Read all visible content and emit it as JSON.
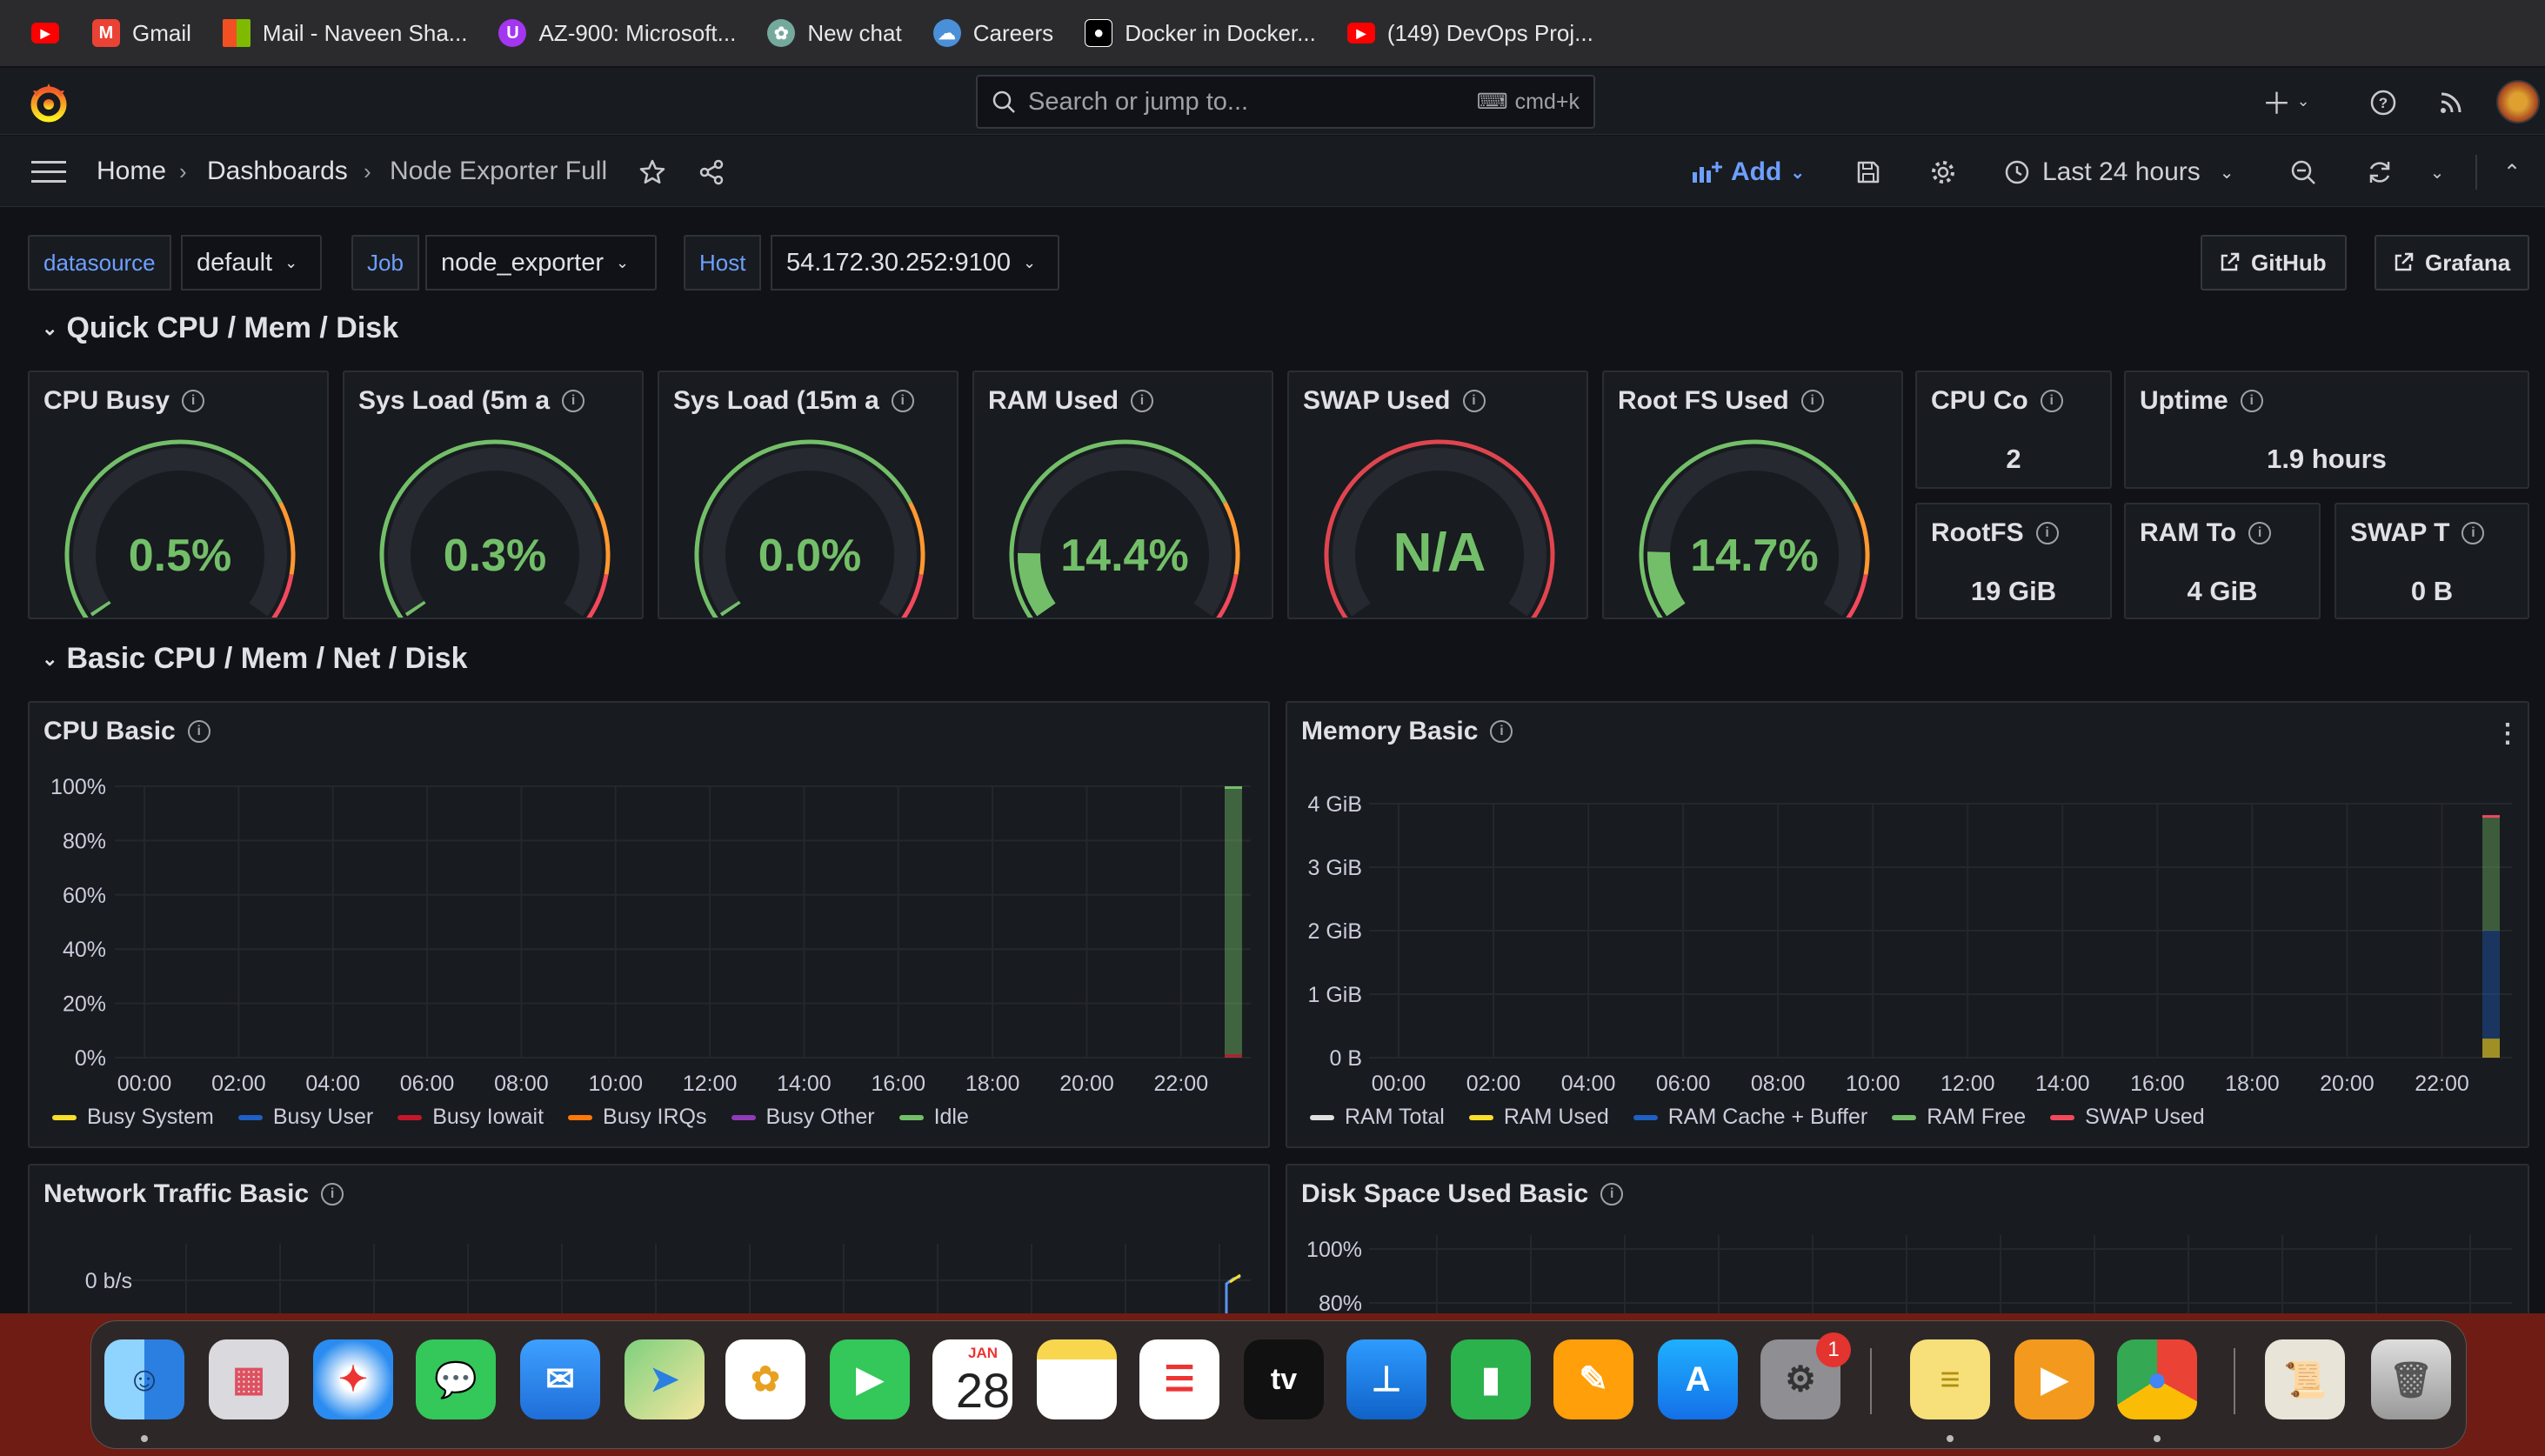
{
  "bookmarks": [
    {
      "label": "",
      "icon": "youtube-icon",
      "color": "#ff0000"
    },
    {
      "label": "Gmail",
      "icon": "gmail-icon",
      "color": "#ea4335"
    },
    {
      "label": "Mail - Naveen Sha...",
      "icon": "microsoft-icon",
      "color": "#f25022"
    },
    {
      "label": "AZ-900: Microsoft...",
      "icon": "udemy-icon",
      "color": "#a435f0"
    },
    {
      "label": "New chat",
      "icon": "chatgpt-icon",
      "color": "#74aa9c"
    },
    {
      "label": "Careers",
      "icon": "careers-icon",
      "color": "#4a90d9"
    },
    {
      "label": "Docker in Docker...",
      "icon": "medium-icon",
      "color": "#000000"
    },
    {
      "label": "(149) DevOps Proj...",
      "icon": "youtube-icon",
      "color": "#ff0000"
    }
  ],
  "topnav": {
    "search_placeholder": "Search or jump to...",
    "search_shortcut": "cmd+k"
  },
  "breadcrumb": {
    "home": "Home",
    "dashboards": "Dashboards",
    "current": "Node Exporter Full"
  },
  "toolbar": {
    "add_label": "Add",
    "time_range": "Last 24 hours"
  },
  "variables": {
    "datasource_label": "datasource",
    "datasource_value": "default",
    "job_label": "Job",
    "job_value": "node_exporter",
    "host_label": "Host",
    "host_value": "54.172.30.252:9100",
    "github_link": "GitHub",
    "grafana_link": "Grafana"
  },
  "rows": {
    "quick": "Quick CPU / Mem / Disk",
    "basic": "Basic CPU / Mem / Net / Disk"
  },
  "gauges": [
    {
      "title": "CPU Busy",
      "value_text": "0.5%",
      "value": 0.5,
      "value_color": "#73bf69"
    },
    {
      "title": "Sys Load (5m a",
      "value_text": "0.3%",
      "value": 0.3,
      "value_color": "#73bf69"
    },
    {
      "title": "Sys Load (15m a",
      "value_text": "0.0%",
      "value": 0.0,
      "value_color": "#73bf69"
    },
    {
      "title": "RAM Used",
      "value_text": "14.4%",
      "value": 14.4,
      "value_color": "#73bf69"
    },
    {
      "title": "SWAP Used",
      "value_text": "N/A",
      "value": null,
      "value_color": "#73bf69"
    },
    {
      "title": "Root FS Used",
      "value_text": "14.7%",
      "value": 14.7,
      "value_color": "#73bf69"
    }
  ],
  "stats": {
    "cpu_cores": {
      "title": "CPU Co",
      "value": "2"
    },
    "uptime": {
      "title": "Uptime",
      "value": "1.9 hours"
    },
    "rootfs": {
      "title": "RootFS",
      "value": "19 GiB"
    },
    "ram_total": {
      "title": "RAM To",
      "value": "4 GiB"
    },
    "swap_total": {
      "title": "SWAP T",
      "value": "0 B"
    }
  },
  "panels": {
    "cpu_basic": "CPU Basic",
    "memory_basic": "Memory Basic",
    "network_basic": "Network Traffic Basic",
    "disk_basic": "Disk Space Used Basic"
  },
  "chart_data": [
    {
      "type": "area",
      "title": "CPU Basic",
      "x": [
        "00:00",
        "02:00",
        "04:00",
        "06:00",
        "08:00",
        "10:00",
        "12:00",
        "14:00",
        "16:00",
        "18:00",
        "20:00",
        "22:00"
      ],
      "y_ticks": [
        "100%",
        "80%",
        "60%",
        "40%",
        "20%",
        "0%"
      ],
      "ylim": [
        0,
        100
      ],
      "series": [
        {
          "name": "Busy System",
          "color": "#fade2a"
        },
        {
          "name": "Busy User",
          "color": "#1f60c4"
        },
        {
          "name": "Busy Iowait",
          "color": "#c4162a"
        },
        {
          "name": "Busy IRQs",
          "color": "#ff780a"
        },
        {
          "name": "Busy Other",
          "color": "#8f3bb8"
        },
        {
          "name": "Idle",
          "color": "#73bf69",
          "last_value": 99.5
        }
      ]
    },
    {
      "type": "area",
      "title": "Memory Basic",
      "x": [
        "00:00",
        "02:00",
        "04:00",
        "06:00",
        "08:00",
        "10:00",
        "12:00",
        "14:00",
        "16:00",
        "18:00",
        "20:00",
        "22:00"
      ],
      "y_ticks": [
        "4 GiB",
        "3 GiB",
        "2 GiB",
        "1 GiB",
        "0 B"
      ],
      "ylim": [
        0,
        4
      ],
      "series": [
        {
          "name": "RAM Total",
          "color": "#e0e0e0"
        },
        {
          "name": "RAM Used",
          "color": "#fade2a",
          "last_value": 0.3
        },
        {
          "name": "RAM Cache + Buffer",
          "color": "#1f60c4",
          "last_value": 2.0
        },
        {
          "name": "RAM Free",
          "color": "#73bf69",
          "last_value": 3.8
        },
        {
          "name": "SWAP Used",
          "color": "#f2495c"
        }
      ]
    },
    {
      "type": "line",
      "title": "Network Traffic Basic",
      "y_ticks": [
        "0 b/s"
      ]
    },
    {
      "type": "area",
      "title": "Disk Space Used Basic",
      "y_ticks": [
        "100%",
        "80%"
      ]
    }
  ],
  "dock": {
    "calendar_month": "JAN",
    "calendar_day": "28",
    "settings_badge": "1",
    "apps": [
      "finder-icon",
      "launchpad-icon",
      "safari-icon",
      "messages-icon",
      "mail-icon",
      "maps-icon",
      "photos-icon",
      "facetime-icon",
      "calendar-icon",
      "notes-icon",
      "reminders-icon",
      "appletv-icon",
      "keynote-icon",
      "numbers-icon",
      "pages-icon",
      "appstore-icon",
      "settings-icon",
      "stickies-icon",
      "infuse-icon",
      "chrome-icon",
      "certificate-icon",
      "trash-icon"
    ]
  }
}
